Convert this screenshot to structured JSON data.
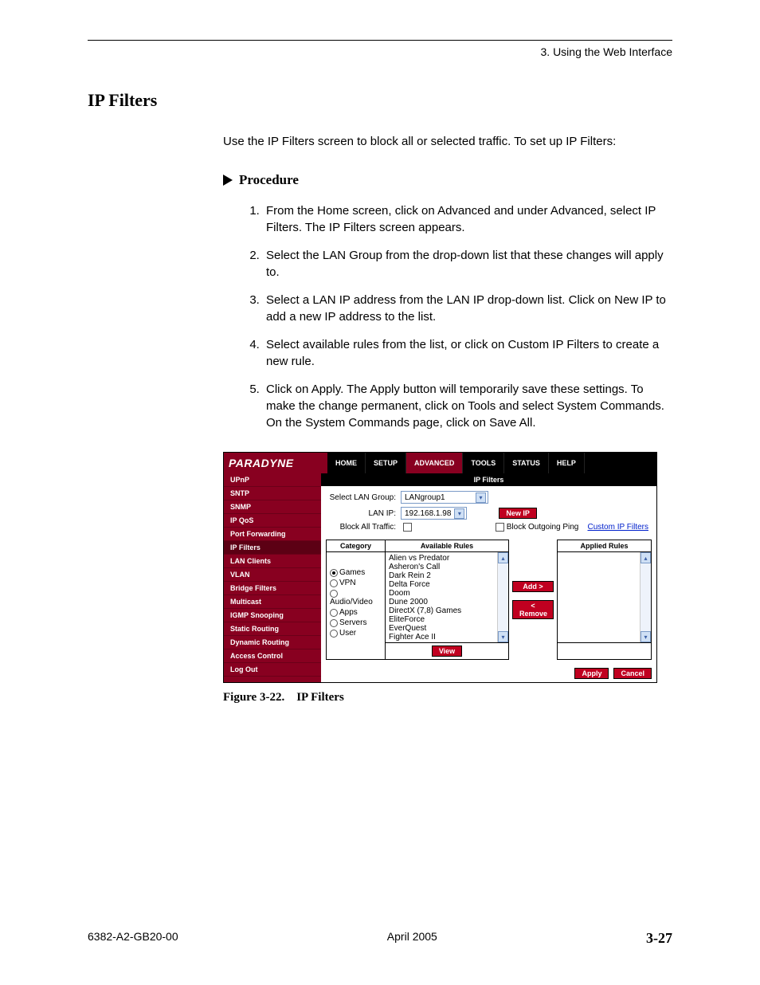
{
  "header": "3. Using the Web Interface",
  "section_title": "IP Filters",
  "intro": "Use the IP Filters screen to block all or selected traffic. To set up IP Filters:",
  "procedure_label": "Procedure",
  "steps": [
    "From the Home screen, click on Advanced and under Advanced, select IP Filters. The IP Filters screen appears.",
    "Select the LAN Group from the drop-down list that these changes will apply to.",
    "Select a LAN IP address from the LAN IP drop-down list. Click on New IP to add a new IP address to the list.",
    " Select available rules from the list, or click on Custom IP Filters to create a new rule.",
    "Click on Apply. The Apply button will temporarily save these settings. To make the change permanent, click on Tools and select System Commands. On the System Commands page, click on Save All."
  ],
  "router": {
    "brand": "PARADYNE",
    "tabs": [
      "HOME",
      "SETUP",
      "ADVANCED",
      "TOOLS",
      "STATUS",
      "HELP"
    ],
    "active_tab": 2,
    "sidebar": [
      "UPnP",
      "SNTP",
      "SNMP",
      "IP QoS",
      "Port Forwarding",
      "IP Filters",
      "LAN Clients",
      "VLAN",
      "Bridge Filters",
      "Multicast",
      "IGMP Snooping",
      "Static Routing",
      "Dynamic Routing",
      "Access Control",
      "Log Out"
    ],
    "active_side": 5,
    "content_title": "IP Filters",
    "lan_group_label": "Select LAN Group:",
    "lan_group_value": "LANgroup1",
    "lan_ip_label": "LAN IP:",
    "lan_ip_value": "192.168.1.98",
    "new_ip": "New IP",
    "block_all_label": "Block All Traffic:",
    "block_outgoing_label": "Block Outgoing Ping",
    "custom_link": "Custom IP Filters",
    "category_head": "Category",
    "available_head": "Available Rules",
    "applied_head": "Applied Rules",
    "categories": [
      "Games",
      "VPN",
      "Audio/Video",
      "Apps",
      "Servers",
      "User"
    ],
    "category_selected": 0,
    "available_rules": [
      "Alien vs Predator",
      "Asheron's Call",
      "Dark Rein 2",
      "Delta Force",
      "Doom",
      "Dune 2000",
      "DirectX (7,8) Games",
      "EliteForce",
      "EverQuest",
      "Fighter Ace II"
    ],
    "add_btn": "Add >",
    "remove_btn": "< Remove",
    "view_btn": "View",
    "apply_btn": "Apply",
    "cancel_btn": "Cancel"
  },
  "figure_caption": "Figure 3-22. IP Filters",
  "footer": {
    "left": "6382-A2-GB20-00",
    "center": "April 2005",
    "right": "3-27"
  }
}
